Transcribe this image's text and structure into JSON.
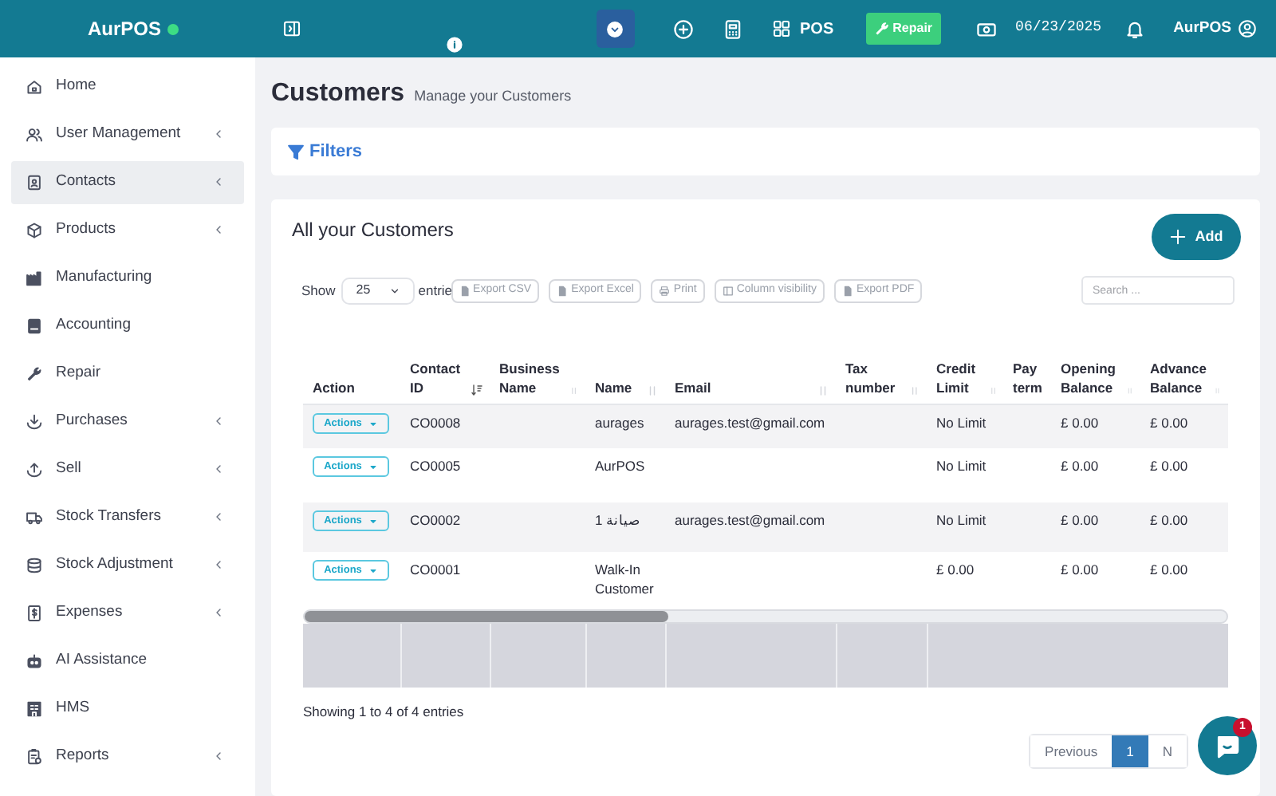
{
  "header": {
    "brand": "AurPOS",
    "pos_label": "POS",
    "repair_label": "Repair",
    "date": "06/23/2025",
    "user": "AurPOS"
  },
  "sidebar": {
    "items": [
      {
        "label": "Home",
        "kind": "home",
        "has_submenu": false,
        "selected": false
      },
      {
        "label": "User Management",
        "kind": "users",
        "has_submenu": true,
        "selected": false
      },
      {
        "label": "Contacts",
        "kind": "contact",
        "has_submenu": true,
        "selected": true
      },
      {
        "label": "Products",
        "kind": "box",
        "has_submenu": true,
        "selected": false
      },
      {
        "label": "Manufacturing",
        "kind": "factory",
        "has_submenu": false,
        "selected": false
      },
      {
        "label": "Accounting",
        "kind": "book",
        "has_submenu": false,
        "selected": false
      },
      {
        "label": "Repair",
        "kind": "wrench",
        "has_submenu": false,
        "selected": false
      },
      {
        "label": "Purchases",
        "kind": "download",
        "has_submenu": true,
        "selected": false
      },
      {
        "label": "Sell",
        "kind": "upload",
        "has_submenu": true,
        "selected": false
      },
      {
        "label": "Stock Transfers",
        "kind": "truck",
        "has_submenu": true,
        "selected": false
      },
      {
        "label": "Stock Adjustment",
        "kind": "database",
        "has_submenu": true,
        "selected": false
      },
      {
        "label": "Expenses",
        "kind": "dollar",
        "has_submenu": true,
        "selected": false
      },
      {
        "label": "AI Assistance",
        "kind": "robot",
        "has_submenu": false,
        "selected": false
      },
      {
        "label": "HMS",
        "kind": "building",
        "has_submenu": false,
        "selected": false
      },
      {
        "label": "Reports",
        "kind": "report",
        "has_submenu": true,
        "selected": false
      }
    ]
  },
  "page": {
    "title": "Customers",
    "subtitle": "Manage your Customers",
    "filters": "Filters"
  },
  "card": {
    "title": "All your Customers",
    "add": "Add",
    "show": "Show",
    "entries_value": "25",
    "entries_label": "entrie",
    "buttons": [
      {
        "label": "Export CSV",
        "kind": "file"
      },
      {
        "label": "Export Excel",
        "kind": "file"
      },
      {
        "label": "Print",
        "kind": "print"
      },
      {
        "label": "Column visibility",
        "kind": "columns"
      },
      {
        "label": "Export PDF",
        "kind": "file"
      }
    ],
    "search": {
      "placeholder": "Search ..."
    }
  },
  "table": {
    "columns": [
      {
        "label": "Action",
        "sortable": false
      },
      {
        "label": "Contact ID",
        "sortable": true,
        "sorted": true
      },
      {
        "label": "Business Name",
        "sortable": true,
        "sorted": false
      },
      {
        "label": "Name",
        "sortable": true,
        "sorted": false
      },
      {
        "label": "Email",
        "sortable": true,
        "sorted": false
      },
      {
        "label": "Tax number",
        "sortable": true,
        "sorted": false
      },
      {
        "label": "Credit Limit",
        "sortable": true,
        "sorted": false
      },
      {
        "label": "Pay term",
        "sortable": false
      },
      {
        "label": "Opening Balance",
        "sortable": true,
        "sorted": false
      },
      {
        "label": "Advance Balance",
        "sortable": true,
        "sorted": false
      }
    ],
    "rows": [
      {
        "cells": [
          "Actions",
          "CO0008",
          "",
          "aurages",
          "aurages.test@gmail.com",
          "",
          "No Limit",
          "",
          "£ 0.00",
          "£ 0.00"
        ]
      },
      {
        "cells": [
          "Actions",
          "CO0005",
          "",
          "AurPOS",
          "",
          "",
          "No Limit",
          "",
          "£ 0.00",
          "£ 0.00"
        ]
      },
      {
        "cells": [
          "Actions",
          "CO0002",
          "",
          "صيانة 1",
          "aurages.test@gmail.com",
          "",
          "No Limit",
          "",
          "£ 0.00",
          "£ 0.00"
        ]
      },
      {
        "cells": [
          "Actions",
          "CO0001",
          "",
          "Walk-In Customer",
          "",
          "",
          "£ 0.00",
          "",
          "£ 0.00",
          "£ 0.00"
        ]
      }
    ]
  },
  "footer": {
    "info": "Showing 1 to 4 of 4 entries",
    "pages": [
      {
        "label": "Previous",
        "selected": false
      },
      {
        "label": "1",
        "selected": true
      },
      {
        "label": "N",
        "selected": false
      }
    ]
  },
  "chat": {
    "badge": "1"
  }
}
